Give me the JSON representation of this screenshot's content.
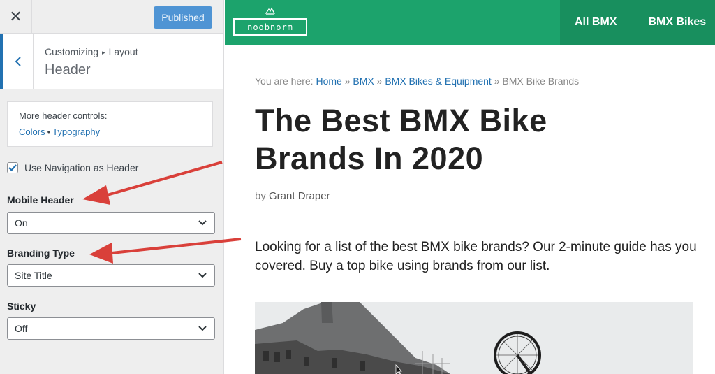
{
  "customizer": {
    "close_glyph": "✕",
    "publish_label": "Published",
    "breadcrumb": [
      "Customizing",
      "Layout"
    ],
    "breadcrumb_sep": "▸",
    "section_title": "Header",
    "more_controls": {
      "title": "More header controls:",
      "links": [
        "Colors",
        "Typography"
      ],
      "separator": "•"
    },
    "use_nav_checkbox": {
      "label": "Use Navigation as Header",
      "checked": true
    },
    "fields": [
      {
        "label": "Mobile Header",
        "value": "On"
      },
      {
        "label": "Branding Type",
        "value": "Site Title"
      },
      {
        "label": "Sticky",
        "value": "Off"
      }
    ]
  },
  "preview": {
    "logo_text": "noobnorm",
    "nav": [
      "All BMX",
      "BMX Bikes"
    ],
    "breadcrumb": {
      "prefix": "You are here:",
      "links": [
        "Home",
        "BMX",
        "BMX Bikes & Equipment"
      ],
      "current": "BMX Bike Brands",
      "sep": "»"
    },
    "title": "The Best BMX Bike Brands In 2020",
    "byline_prefix": "by",
    "author": "Grant Draper",
    "intro": "Looking for a list of the best BMX bike brands? Our 2-minute guide has you covered. Buy a top bike using brands from our list."
  },
  "colors": {
    "accent": "#2271b1",
    "header_green": "#1ca36c",
    "annotation_arrow": "#d9403a"
  }
}
